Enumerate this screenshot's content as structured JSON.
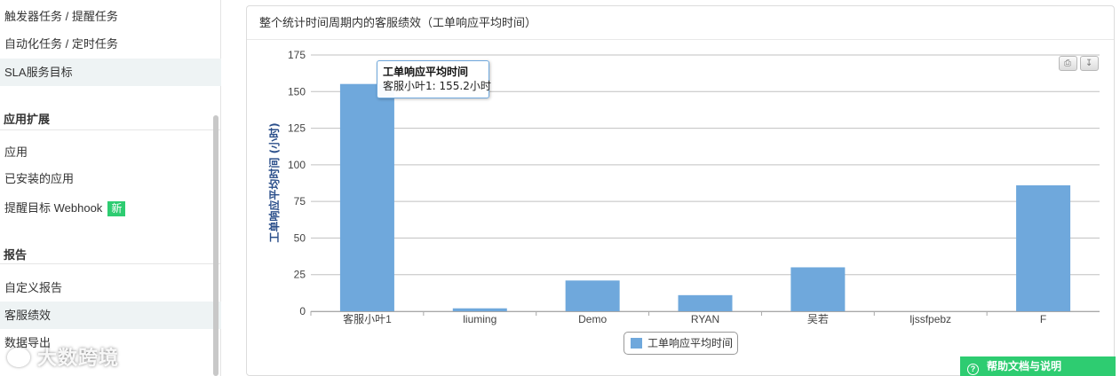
{
  "sidebar": {
    "items_top": [
      {
        "label": "触发器任务 / 提醒任务",
        "active": false
      },
      {
        "label": "自动化任务 / 定时任务",
        "active": false
      },
      {
        "label": "SLA服务目标",
        "active": true
      }
    ],
    "section_apps": {
      "title": "应用扩展",
      "items": [
        {
          "label": "应用"
        },
        {
          "label": "已安装的应用"
        },
        {
          "label": "提醒目标 Webhook",
          "badge": "新"
        }
      ]
    },
    "section_reports": {
      "title": "报告",
      "items": [
        {
          "label": "自定义报告",
          "active": false
        },
        {
          "label": "客服绩效",
          "active": true
        },
        {
          "label": "数据导出",
          "active": false
        }
      ]
    },
    "watermark": "大数跨境"
  },
  "panel": {
    "title": "整个统计时间周期内的客服绩效（工单响应平均时间）"
  },
  "chart_buttons": {
    "print_icon": "print-icon",
    "export_icon": "download-icon"
  },
  "tooltip": {
    "title": "工单响应平均时间",
    "line": "客服小叶1: 155.2小时"
  },
  "help": {
    "icon": "question-circle-icon",
    "label": "帮助文档与说明"
  },
  "colors": {
    "bar": "#6fa8dc",
    "badge": "#2ecc71",
    "axis_title": "#2a4e8a"
  },
  "chart_data": {
    "type": "bar",
    "title": "",
    "xlabel": "",
    "ylabel": "工单响应平均时间 (小时)",
    "ylim": [
      0,
      175
    ],
    "yticks": [
      "0",
      "25",
      "50",
      "75",
      "100",
      "125",
      "150",
      "175"
    ],
    "categories": [
      "客服小叶1",
      "liuming",
      "Demo",
      "RYAN",
      "吴若",
      "ljssfpebz",
      "F"
    ],
    "series": [
      {
        "name": "工单响应平均时间",
        "values": [
          155.2,
          2,
          21,
          11,
          30,
          0,
          86
        ]
      }
    ],
    "grid": true,
    "legend": "bottom-center"
  }
}
